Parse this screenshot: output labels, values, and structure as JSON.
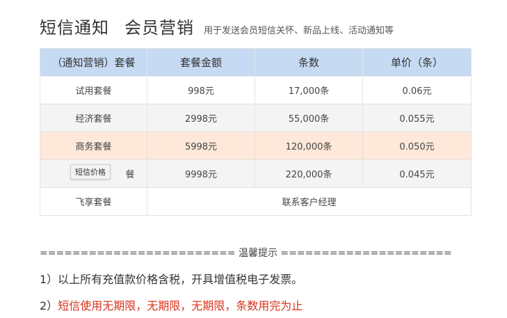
{
  "header": {
    "title": "短信通知",
    "subtitle": "会员营销",
    "description": "用于发送会员短信关怀、新品上线、活动通知等"
  },
  "table": {
    "headers": [
      "（通知营销）套餐",
      "套餐金额",
      "条数",
      "单价（条）"
    ],
    "rows": [
      {
        "name": "试用套餐",
        "price": "998元",
        "count": "17,000条",
        "unit": "0.06元"
      },
      {
        "name": "经济套餐",
        "price": "2998元",
        "count": "55,000条",
        "unit": "0.055元"
      },
      {
        "name": "商务套餐",
        "price": "5998元",
        "count": "120,000条",
        "unit": "0.050元"
      },
      {
        "name": "",
        "price": "9998元",
        "count": "220,000条",
        "unit": "0.045元"
      }
    ],
    "last_row": {
      "name": "飞享套餐",
      "contact": "联系客户经理"
    }
  },
  "tooltip": {
    "text": "短信价格",
    "partial_cell_text": "餐"
  },
  "tips": {
    "divider": "======================== 温馨提示 =====================",
    "line1": "1）以上所有充值款价格含税，开具增值税电子发票。",
    "line2_prefix": "2）",
    "line2_highlight": "短信使用无期限，无期限，无期限，条数用完为止"
  },
  "colors": {
    "header_bg": "#c6daf3",
    "highlight_row": "#fde8d9",
    "striped_row": "#f4f4f4",
    "warning_text": "#d9331e"
  }
}
